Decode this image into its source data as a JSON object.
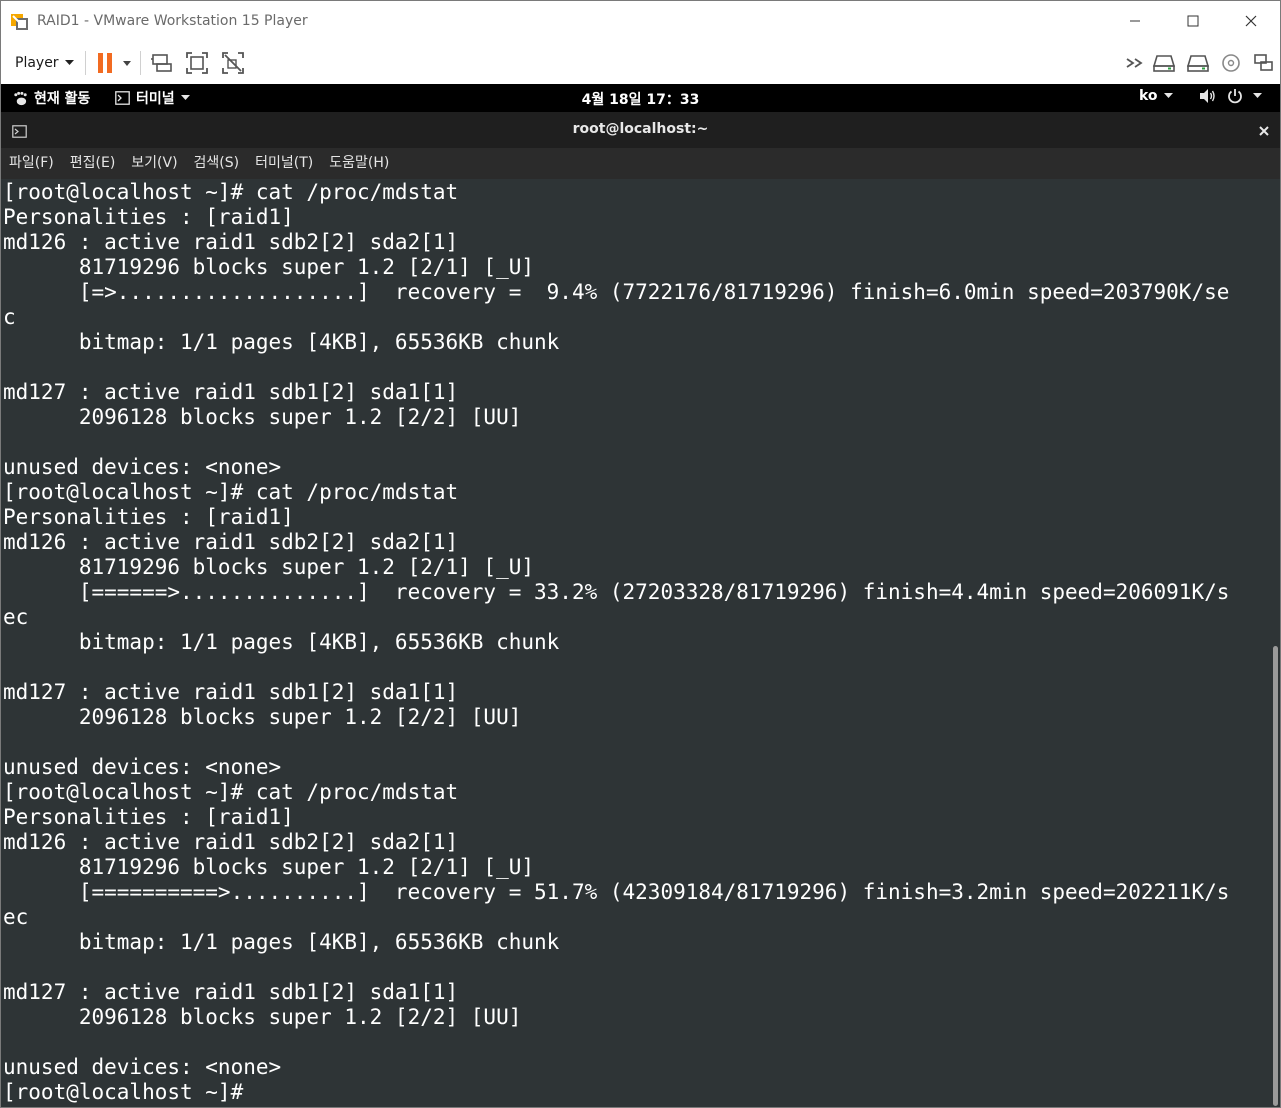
{
  "window": {
    "title": "RAID1 - VMware Workstation 15 Player"
  },
  "player_toolbar": {
    "menu_label": "Player",
    "icons": [
      "pause-icon",
      "send-ctrl-alt-del-icon",
      "fit-guest-icon",
      "unity-icon",
      "forward-icon",
      "hard-disk-icon",
      "network-adapter-icon",
      "cd-dvd-icon",
      "display-icon"
    ],
    "accent_color": "#f26b21"
  },
  "gnome_topbar": {
    "activities_label": "현재 활동",
    "app_menu_label": "터미널",
    "clock": "4월 18일  17：33",
    "input_method": "ko"
  },
  "terminal": {
    "title": "root@localhost:~",
    "menu": [
      "파일(F)",
      "편집(E)",
      "보기(V)",
      "검색(S)",
      "터미널(T)",
      "도움말(H)"
    ],
    "background": "#2e3436",
    "lines": [
      "[root@localhost ~]# cat /proc/mdstat",
      "Personalities : [raid1]",
      "md126 : active raid1 sdb2[2] sda2[1]",
      "      81719296 blocks super 1.2 [2/1] [_U]",
      "      [=>...................]  recovery =  9.4% (7722176/81719296) finish=6.0min speed=203790K/se",
      "c",
      "      bitmap: 1/1 pages [4KB], 65536KB chunk",
      "",
      "md127 : active raid1 sdb1[2] sda1[1]",
      "      2096128 blocks super 1.2 [2/2] [UU]",
      "",
      "unused devices: <none>",
      "[root@localhost ~]# cat /proc/mdstat",
      "Personalities : [raid1]",
      "md126 : active raid1 sdb2[2] sda2[1]",
      "      81719296 blocks super 1.2 [2/1] [_U]",
      "      [======>..............]  recovery = 33.2% (27203328/81719296) finish=4.4min speed=206091K/s",
      "ec",
      "      bitmap: 1/1 pages [4KB], 65536KB chunk",
      "",
      "md127 : active raid1 sdb1[2] sda1[1]",
      "      2096128 blocks super 1.2 [2/2] [UU]",
      "",
      "unused devices: <none>",
      "[root@localhost ~]# cat /proc/mdstat",
      "Personalities : [raid1]",
      "md126 : active raid1 sdb2[2] sda2[1]",
      "      81719296 blocks super 1.2 [2/1] [_U]",
      "      [==========>..........]  recovery = 51.7% (42309184/81719296) finish=3.2min speed=202211K/s",
      "ec",
      "      bitmap: 1/1 pages [4KB], 65536KB chunk",
      "",
      "md127 : active raid1 sdb1[2] sda1[1]",
      "      2096128 blocks super 1.2 [2/2] [UU]",
      "",
      "unused devices: <none>",
      "[root@localhost ~]# "
    ]
  }
}
